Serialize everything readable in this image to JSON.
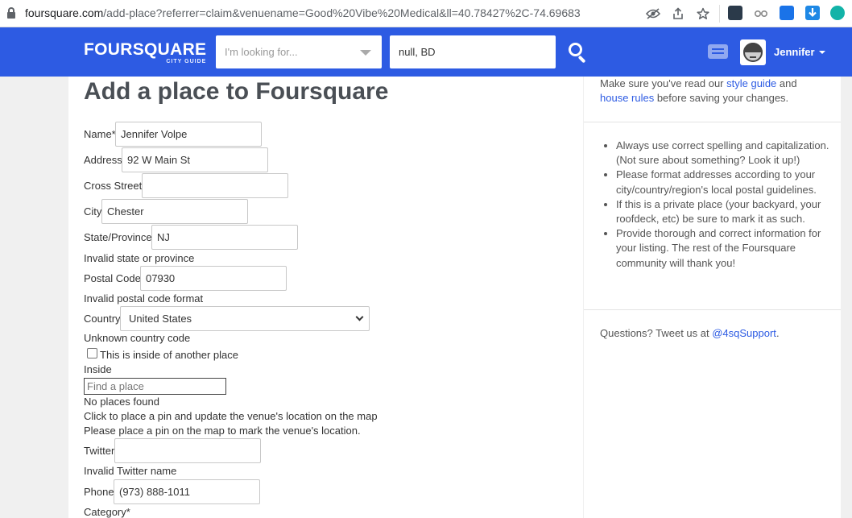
{
  "browser": {
    "url_host": "foursquare.com",
    "url_path": "/add-place?referrer=claim&venuename=Good%20Vibe%20Medical&ll=40.78427%2C-74.69683",
    "ext_colors": [
      "#2b3a4a",
      "#888888",
      "#1a73e8",
      "#1e88e5",
      "#12b3a8"
    ]
  },
  "header": {
    "logo_main": "FOURSQUARE",
    "logo_sub": "CITY GUIDE",
    "search_placeholder": "I'm looking for...",
    "near_value": "null, BD",
    "user_name": "Jennifer",
    "brand_color": "#2d5be3"
  },
  "page": {
    "title": "Add a place to Foursquare"
  },
  "form": {
    "name_label": "Name*",
    "name_value": "Jennifer Volpe",
    "address_label": "Address",
    "address_value": "92 W Main St",
    "cross_street_label": "Cross Street",
    "cross_street_value": "",
    "city_label": "City",
    "city_value": "Chester",
    "state_label": "State/Province",
    "state_value": "NJ",
    "state_error": "Invalid state or province",
    "postal_label": "Postal Code",
    "postal_value": "07930",
    "postal_error": "Invalid postal code format",
    "country_label": "Country",
    "country_value": "United States",
    "country_error": "Unknown country code",
    "inside_checkbox_label": "This is inside of another place",
    "inside_label": "Inside",
    "find_place_placeholder": "Find a place",
    "no_places": "No places found",
    "map_hint": "Click to place a pin and update the venue's location on the map",
    "map_pin_warning": "Please place a pin on the map to mark the venue's location.",
    "twitter_label": "Twitter",
    "twitter_value": "",
    "twitter_error": "Invalid Twitter name",
    "phone_label": "Phone",
    "phone_value": "(973) 888-1011",
    "category_label": "Category*"
  },
  "sidebar": {
    "intro_pre": "Make sure you've read our ",
    "style_guide_link": "style guide",
    "intro_and": " and",
    "house_rules_link": "house rules",
    "intro_post": " before saving your changes.",
    "tips": [
      "Always use correct spelling and capitalization. (Not sure about something? Look it up!)",
      "Please format addresses according to your city/country/region's local postal guidelines.",
      "If this is a private place (your backyard, your roofdeck, etc) be sure to mark it as such.",
      "Provide thorough and correct information for your listing. The rest of the Foursquare community will thank you!"
    ],
    "questions_pre": "Questions? Tweet us at ",
    "support_link": "@4sqSupport",
    "questions_post": "."
  }
}
